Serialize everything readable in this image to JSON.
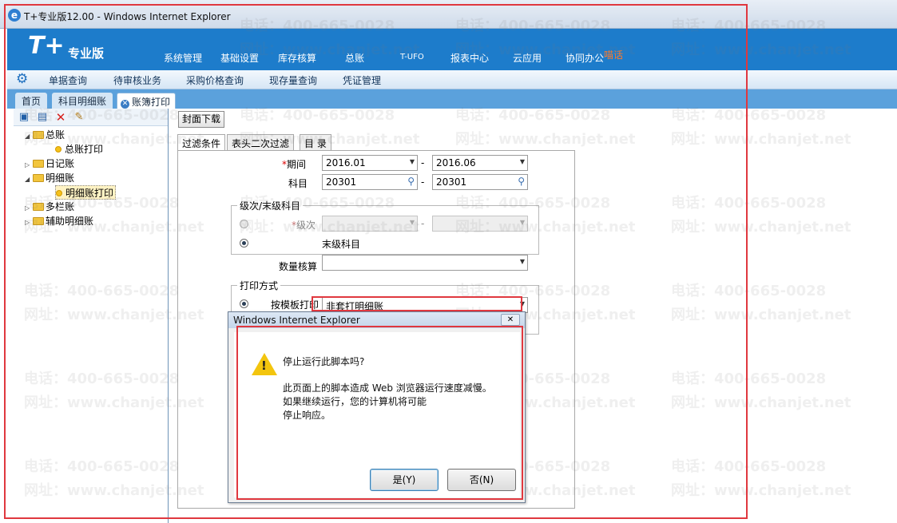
{
  "window": {
    "title": "T+专业版12.00 - Windows Internet Explorer"
  },
  "app": {
    "logo": "T+",
    "logo_sub": "专业版",
    "menu": [
      "系统管理",
      "基础设置",
      "库存核算",
      "总账",
      "T-UFO",
      "报表中心",
      "云应用",
      "协同办公"
    ],
    "menu_badge": "喵话"
  },
  "subnav": [
    "单据查询",
    "待审核业务",
    "采购价格查询",
    "现存量查询",
    "凭证管理"
  ],
  "tabs": [
    "首页",
    "科目明细账",
    "账簿打印"
  ],
  "tree": {
    "items": [
      {
        "label": "总账",
        "expanded": true
      },
      {
        "label": "总账打印",
        "leaf": true
      },
      {
        "label": "日记账",
        "expanded": false
      },
      {
        "label": "明细账",
        "expanded": true
      },
      {
        "label": "明细账打印",
        "leaf": true
      },
      {
        "label": "多栏账",
        "expanded": false
      },
      {
        "label": "辅助明细账",
        "expanded": false
      }
    ]
  },
  "main": {
    "cover_download": "封面下载",
    "form_tabs": [
      "过滤条件",
      "表头二次过滤",
      "目 录"
    ],
    "period_label": "期间",
    "period_from": "2016.01",
    "period_to": "2016.06",
    "range_sep": "-",
    "subject_label": "科目",
    "subject_from": "20301",
    "subject_to": "20301",
    "level_group": "级次/末级科目",
    "level_label": "级次",
    "last_level_label": "末级科目",
    "qty_label": "数量核算",
    "print_group": "打印方式",
    "template_label": "按模板打印",
    "template_value": "非套打明细账"
  },
  "dialog": {
    "title": "Windows Internet Explorer",
    "close": "✕",
    "line1": "停止运行此脚本吗?",
    "line2": "此页面上的脚本造成 Web 浏览器运行速度减慢。",
    "line3": "如果继续运行，您的计算机将可能",
    "line4": "停止响应。",
    "yes": "是(Y)",
    "no": "否(N)"
  },
  "watermark": {
    "phone": "电话：400-665-0028",
    "site": "网址：www.chanjet.net"
  },
  "colors": {
    "header_blue": "#1d7ccb",
    "annotation_red": "#e0383f",
    "warning_yellow": "#f3c50e"
  }
}
